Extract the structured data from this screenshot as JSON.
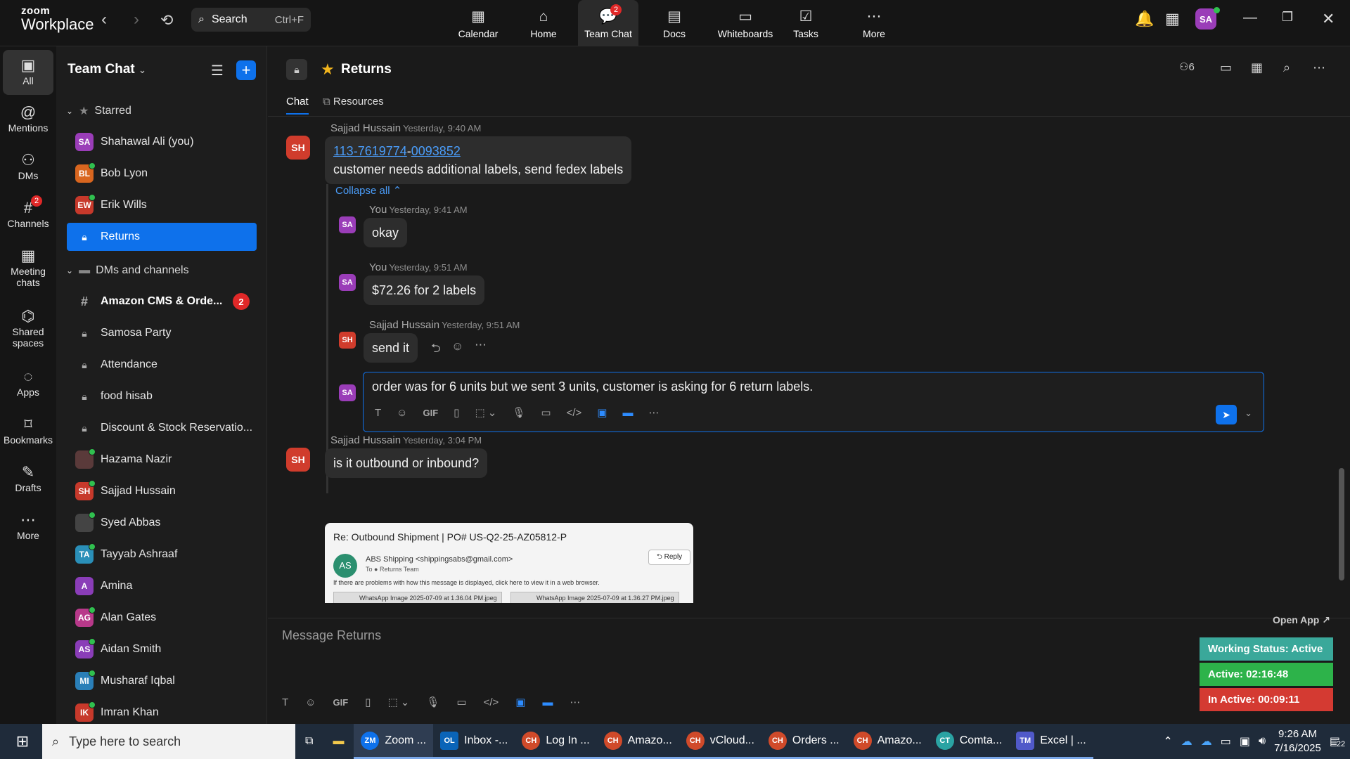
{
  "topbar": {
    "logo_top": "zoom",
    "logo_bottom": "Workplace",
    "search_label": "Search",
    "search_shortcut": "Ctrl+F",
    "tabs": [
      {
        "label": "Calendar",
        "icon": "calendar-icon"
      },
      {
        "label": "Home",
        "icon": "home-icon"
      },
      {
        "label": "Team Chat",
        "icon": "chat-icon",
        "badge": "2"
      },
      {
        "label": "Docs",
        "icon": "docs-icon"
      },
      {
        "label": "Whiteboards",
        "icon": "whiteboard-icon"
      },
      {
        "label": "Tasks",
        "icon": "tasks-icon"
      },
      {
        "label": "More",
        "icon": "more-icon"
      }
    ],
    "user_initials": "SA"
  },
  "leftnav": {
    "items": [
      {
        "label": "All",
        "icon": "chat-bubble-icon"
      },
      {
        "label": "Mentions",
        "icon": "at-icon"
      },
      {
        "label": "DMs",
        "icon": "people-icon"
      },
      {
        "label": "Channels",
        "icon": "hash-icon",
        "badge": "2"
      },
      {
        "label": "Meeting\nchats",
        "icon": "calendar-icon"
      },
      {
        "label": "Shared\nspaces",
        "icon": "shared-icon"
      },
      {
        "label": "Apps",
        "icon": "apps-icon"
      },
      {
        "label": "Bookmarks",
        "icon": "bookmark-icon"
      },
      {
        "label": "Drafts",
        "icon": "drafts-icon"
      },
      {
        "label": "More",
        "icon": "more-icon"
      }
    ]
  },
  "sidebar": {
    "title": "Team Chat",
    "starred_label": "Starred",
    "dms_label": "DMs and channels",
    "starred": [
      {
        "label": "Shahawal Ali (you)",
        "initials": "SA",
        "color": "#9a3db8"
      },
      {
        "label": "Bob Lyon",
        "initials": "BL",
        "color": "#d9661f"
      },
      {
        "label": "Erik Wills",
        "initials": "EW",
        "color": "#c7392b"
      },
      {
        "label": "Returns",
        "type": "lock"
      }
    ],
    "channels": [
      {
        "label": "Amazon CMS & Orde...",
        "type": "hash",
        "badge": "2"
      },
      {
        "label": "Samosa Party",
        "type": "lock"
      },
      {
        "label": "Attendance",
        "type": "lock"
      },
      {
        "label": "food hisab",
        "type": "lock"
      },
      {
        "label": "Discount & Stock Reservatio...",
        "type": "lock"
      },
      {
        "label": "Hazama Nazir",
        "initials": "",
        "color": "#5a3a3a"
      },
      {
        "label": "Sajjad Hussain",
        "initials": "SH",
        "color": "#c7392b"
      },
      {
        "label": "Syed Abbas",
        "initials": "",
        "color": "#444"
      },
      {
        "label": "Tayyab Ashraaf",
        "initials": "TA",
        "color": "#2a8fb8"
      },
      {
        "label": "Amina",
        "initials": "A",
        "color": "#8a3db8"
      },
      {
        "label": "Alan Gates",
        "initials": "AG",
        "color": "#b8398a"
      },
      {
        "label": "Aidan Smith",
        "initials": "AS",
        "color": "#8a3db8"
      },
      {
        "label": "Musharaf Iqbal",
        "initials": "MI",
        "color": "#2a7fb8"
      },
      {
        "label": "Imran Khan",
        "initials": "IK",
        "color": "#c7392b"
      }
    ]
  },
  "channel": {
    "name": "Returns",
    "tab_chat": "Chat",
    "tab_resources": "Resources",
    "member_count": "6"
  },
  "messages": {
    "m1_author": "Sajjad Hussain",
    "m1_time": "Yesterday, 9:40 AM",
    "m1_link_a": "113-7619774",
    "m1_dash": "-",
    "m1_link_b": "0093852",
    "m1_text": "customer needs additional labels, send fedex labels",
    "collapse": "Collapse all",
    "r1_author": "You",
    "r1_time": "Yesterday, 9:41 AM",
    "r1_text": "okay",
    "r2_author": "You",
    "r2_time": "Yesterday, 9:51 AM",
    "r2_text": "$72.26  for 2 labels",
    "r3_author": "Sajjad Hussain",
    "r3_time": "Yesterday, 9:51 AM",
    "r3_text": "send it",
    "draft": "order was for 6 units but we sent 3 units, customer is asking for 6 return labels.",
    "m2_author": "Sajjad Hussain",
    "m2_time": "Yesterday, 3:04 PM",
    "m2_text": "is it outbound or inbound?",
    "email": {
      "subject": "Re: Outbound Shipment | PO# US-Q2-25-AZ05812-P",
      "avatar": "AS",
      "from": "ABS Shipping <shippingsabs@gmail.com>",
      "to": "To  ● Returns Team",
      "reply": "Reply",
      "warn": "If there are problems with how this message is displayed, click here to view it in a web browser.",
      "att1": "WhatsApp Image 2025-07-09 at 1.36.04 PM.jpeg",
      "att2": "WhatsApp Image 2025-07-09 at 1.36.27 PM.jpeg"
    }
  },
  "composer": {
    "placeholder": "Message Returns",
    "gif": "GIF"
  },
  "status_overlay": {
    "open_app": "Open App ↗",
    "working": "Working Status: Active",
    "active": "Active: 02:16:48",
    "inactive": "In Active: 00:09:11",
    "colors": {
      "working": "#3aa89a",
      "active": "#2db34a",
      "inactive": "#d43a32"
    }
  },
  "taskbar": {
    "search": "Type here to search",
    "apps": [
      {
        "label": "Zoom ...",
        "color": "#0e71eb",
        "icon": "ZM"
      },
      {
        "label": "Inbox -...",
        "color": "#0a64b8",
        "icon": "OL"
      },
      {
        "label": "Log In ...",
        "color": "#d04a2a",
        "icon": "CH"
      },
      {
        "label": "Amazo...",
        "color": "#d04a2a",
        "icon": "CH"
      },
      {
        "label": "vCloud...",
        "color": "#d04a2a",
        "icon": "CH"
      },
      {
        "label": "Orders ...",
        "color": "#d04a2a",
        "icon": "CH"
      },
      {
        "label": "Amazo...",
        "color": "#d04a2a",
        "icon": "CH"
      },
      {
        "label": "Comta...",
        "color": "#2aa3a3",
        "icon": "CT"
      },
      {
        "label": "Excel | ...",
        "color": "#5059c9",
        "icon": "TM"
      }
    ],
    "time": "9:26 AM",
    "date": "7/16/2025",
    "notif": "22"
  }
}
